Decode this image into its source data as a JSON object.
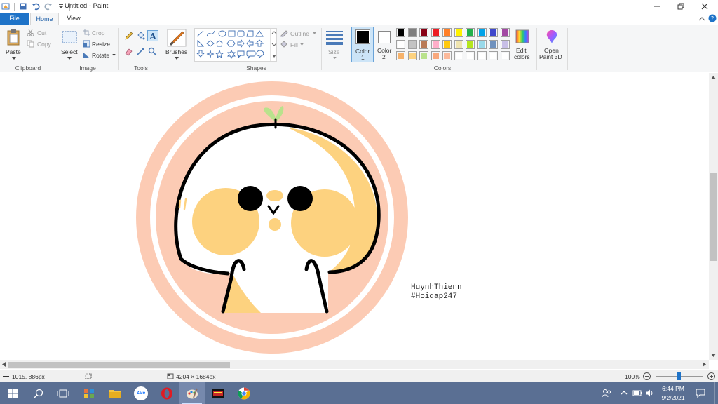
{
  "window": {
    "title": "Untitled - Paint"
  },
  "tabs": {
    "file": "File",
    "home": "Home",
    "view": "View"
  },
  "ribbon": {
    "clipboard": {
      "paste": "Paste",
      "cut": "Cut",
      "copy": "Copy",
      "label": "Clipboard"
    },
    "image": {
      "select": "Select",
      "crop": "Crop",
      "resize": "Resize",
      "rotate": "Rotate",
      "label": "Image"
    },
    "tools": {
      "label": "Tools"
    },
    "brushes": {
      "label": "Brushes"
    },
    "shapes": {
      "outline": "Outline",
      "fill": "Fill",
      "label": "Shapes"
    },
    "size": {
      "label": "Size"
    },
    "colors": {
      "color1_label": "Color",
      "color1_num": "1",
      "color2_label": "Color",
      "color2_num": "2",
      "color1": "#000000",
      "color2": "#ffffff",
      "palette_row1": [
        "#000000",
        "#7f7f7f",
        "#880015",
        "#ed1c24",
        "#ff7f27",
        "#fff200",
        "#22b14c",
        "#00a2e8",
        "#3f48cc",
        "#a349a4"
      ],
      "palette_row2": [
        "#ffffff",
        "#c3c3c3",
        "#b97a57",
        "#ffaec9",
        "#ffc90e",
        "#efe4b0",
        "#b5e61d",
        "#99d9ea",
        "#7092be",
        "#c8bfe7"
      ],
      "palette_row3": [
        "#f6b26b",
        "#fdd27f",
        "#b9e28c",
        "#f9a87c",
        "#fbb99a",
        "#ffffff",
        "#ffffff",
        "#ffffff",
        "#ffffff",
        "#ffffff"
      ],
      "edit_colors_line1": "Edit",
      "edit_colors_line2": "colors",
      "label": "Colors"
    },
    "paint3d": {
      "line1": "Open",
      "line2": "Paint 3D"
    }
  },
  "canvas": {
    "signature_line1": "HuynhThienn",
    "signature_line2": "#Hoidap247",
    "colors": {
      "outer_ring": "#fccbb4",
      "inner_ring": "#ffffff",
      "face_fill": "#ffffff",
      "cheek": "#fdd27f",
      "outline": "#000000",
      "sprout": "#b9e28c"
    }
  },
  "status": {
    "cursor_pos": "1015, 886px",
    "image_size": "4204 × 1684px",
    "zoom": "100%"
  },
  "taskbar": {
    "time": "6:44 PM",
    "date": "9/2/2021",
    "zalo_label": "Zalo",
    "apps": [
      "start-icon",
      "search-icon",
      "task-view-icon",
      "app-grid-icon",
      "file-explorer-icon",
      "zalo-icon",
      "opera-icon",
      "paint-icon",
      "game-icon",
      "chrome-icon"
    ]
  }
}
